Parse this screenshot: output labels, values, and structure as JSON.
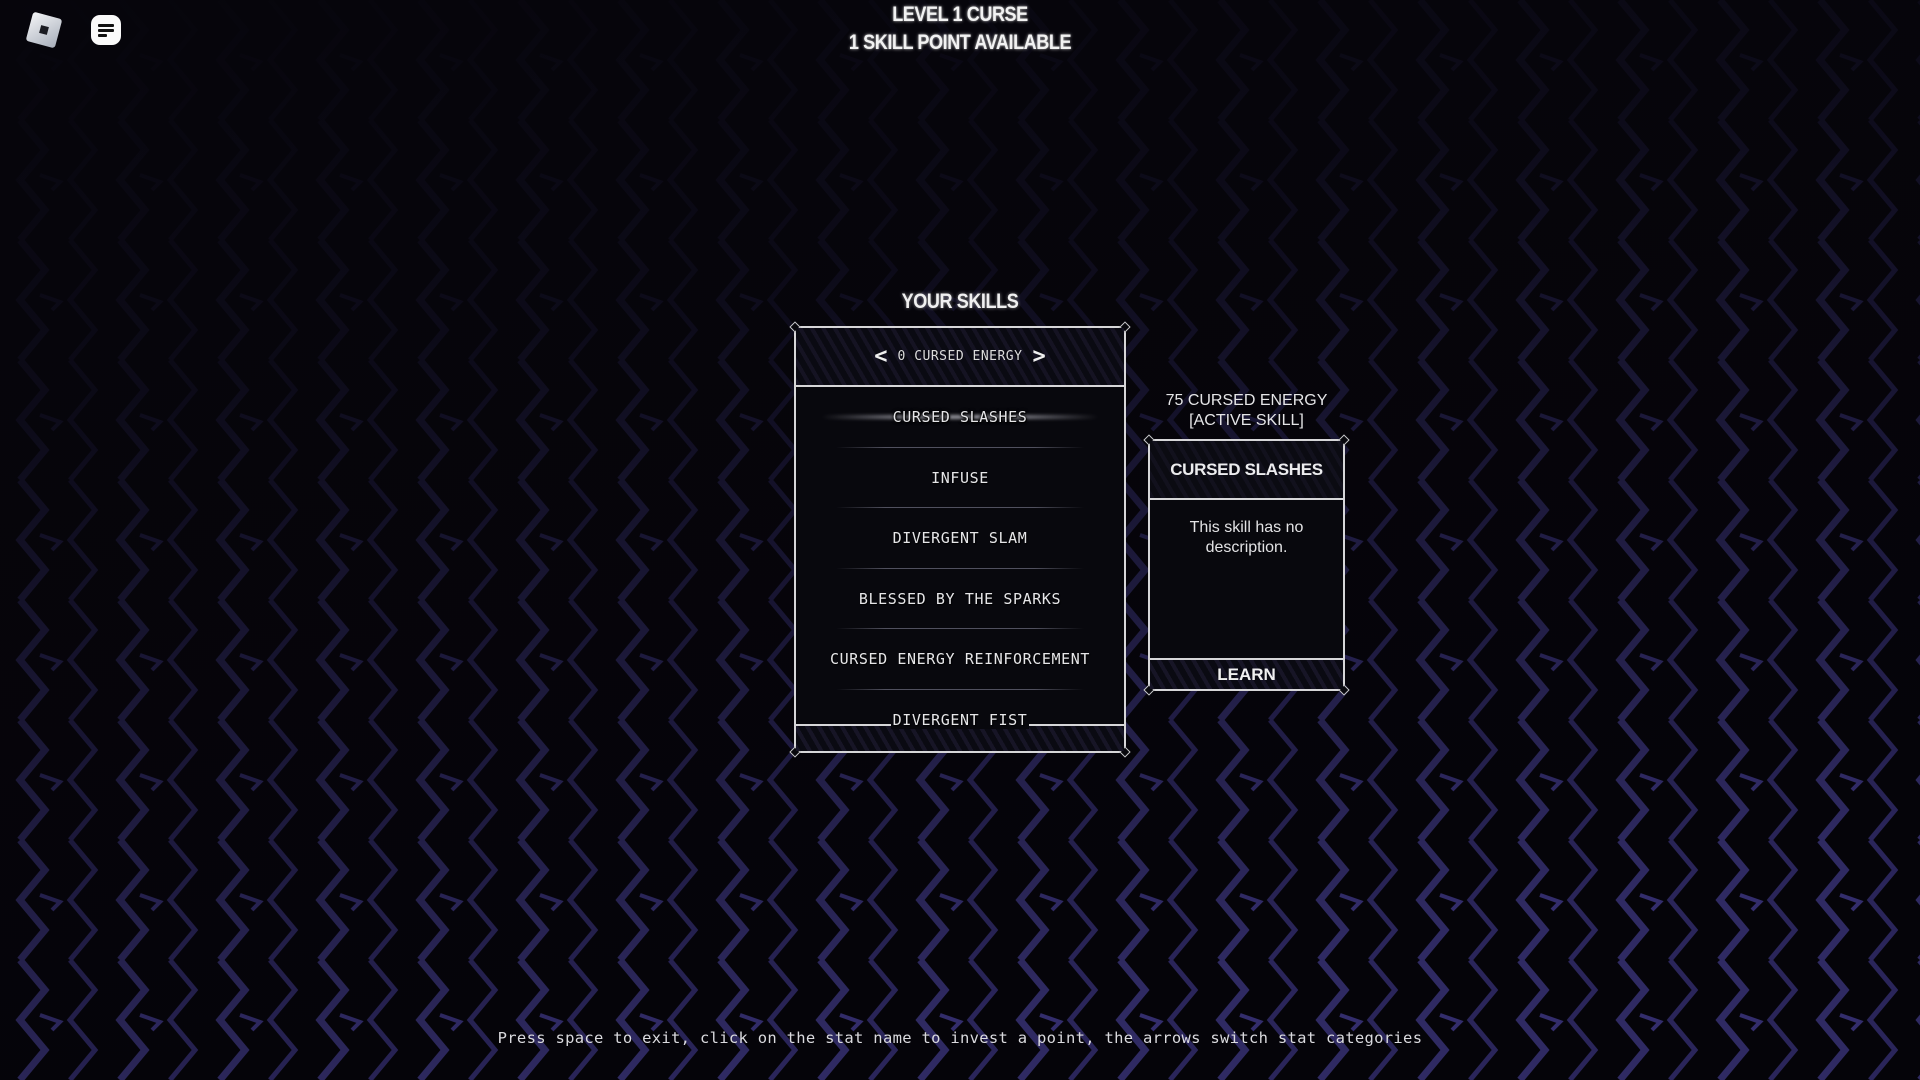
{
  "top_bar": {
    "icons": [
      "roblox-menu-icon",
      "chat-icon"
    ]
  },
  "header": {
    "level": "LEVEL 1 CURSE",
    "skill_points": "1 SKILL POINT AVAILABLE"
  },
  "skills_panel": {
    "title": "YOUR SKILLS",
    "category": {
      "prev_arrow": "<",
      "label": "0 CURSED ENERGY",
      "next_arrow": ">"
    },
    "items": [
      {
        "label": "CURSED SLASHES",
        "selected": true
      },
      {
        "label": "INFUSE",
        "selected": false
      },
      {
        "label": "DIVERGENT SLAM",
        "selected": false
      },
      {
        "label": "BLESSED BY THE SPARKS",
        "selected": false
      },
      {
        "label": "CURSED ENERGY REINFORCEMENT",
        "selected": false
      },
      {
        "label": "DIVERGENT FIST",
        "selected": false
      }
    ]
  },
  "skill_info": {
    "cost": "75 CURSED ENERGY",
    "type": "[ACTIVE SKILL]",
    "name": "CURSED SLASHES",
    "description": "This skill has no description.",
    "learn_label": "LEARN"
  },
  "footer": {
    "hint": "Press space to exit, click on the stat name to invest a point, the arrows switch stat categories"
  },
  "colors": {
    "background": "#06050b",
    "pattern": "#35306a",
    "panel": "#08080d",
    "border": "#d6d6d8",
    "text": "#e8e8ea"
  }
}
